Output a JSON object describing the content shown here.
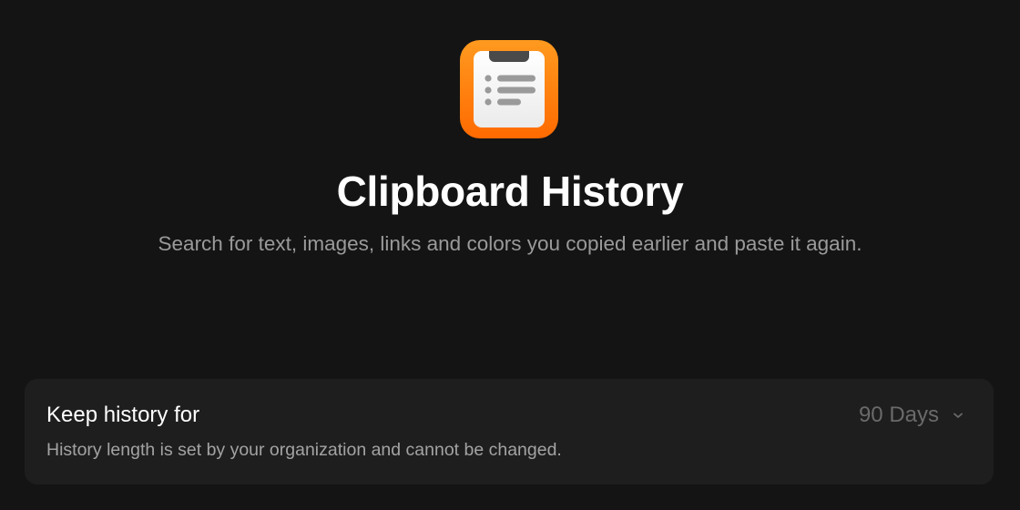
{
  "extension": {
    "icon": "clipboard-list-icon",
    "title": "Clipboard History",
    "subtitle": "Search for text, images, links and colors you copied earlier and paste it again."
  },
  "settings": {
    "keep_history": {
      "label": "Keep history for",
      "description": "History length is set by your organization and cannot be changed.",
      "value": "90 Days",
      "icon": "chevron-down-icon"
    }
  },
  "colors": {
    "background": "#141414",
    "card": "#1e1e1e",
    "icon_orange": "#ff7a00"
  }
}
